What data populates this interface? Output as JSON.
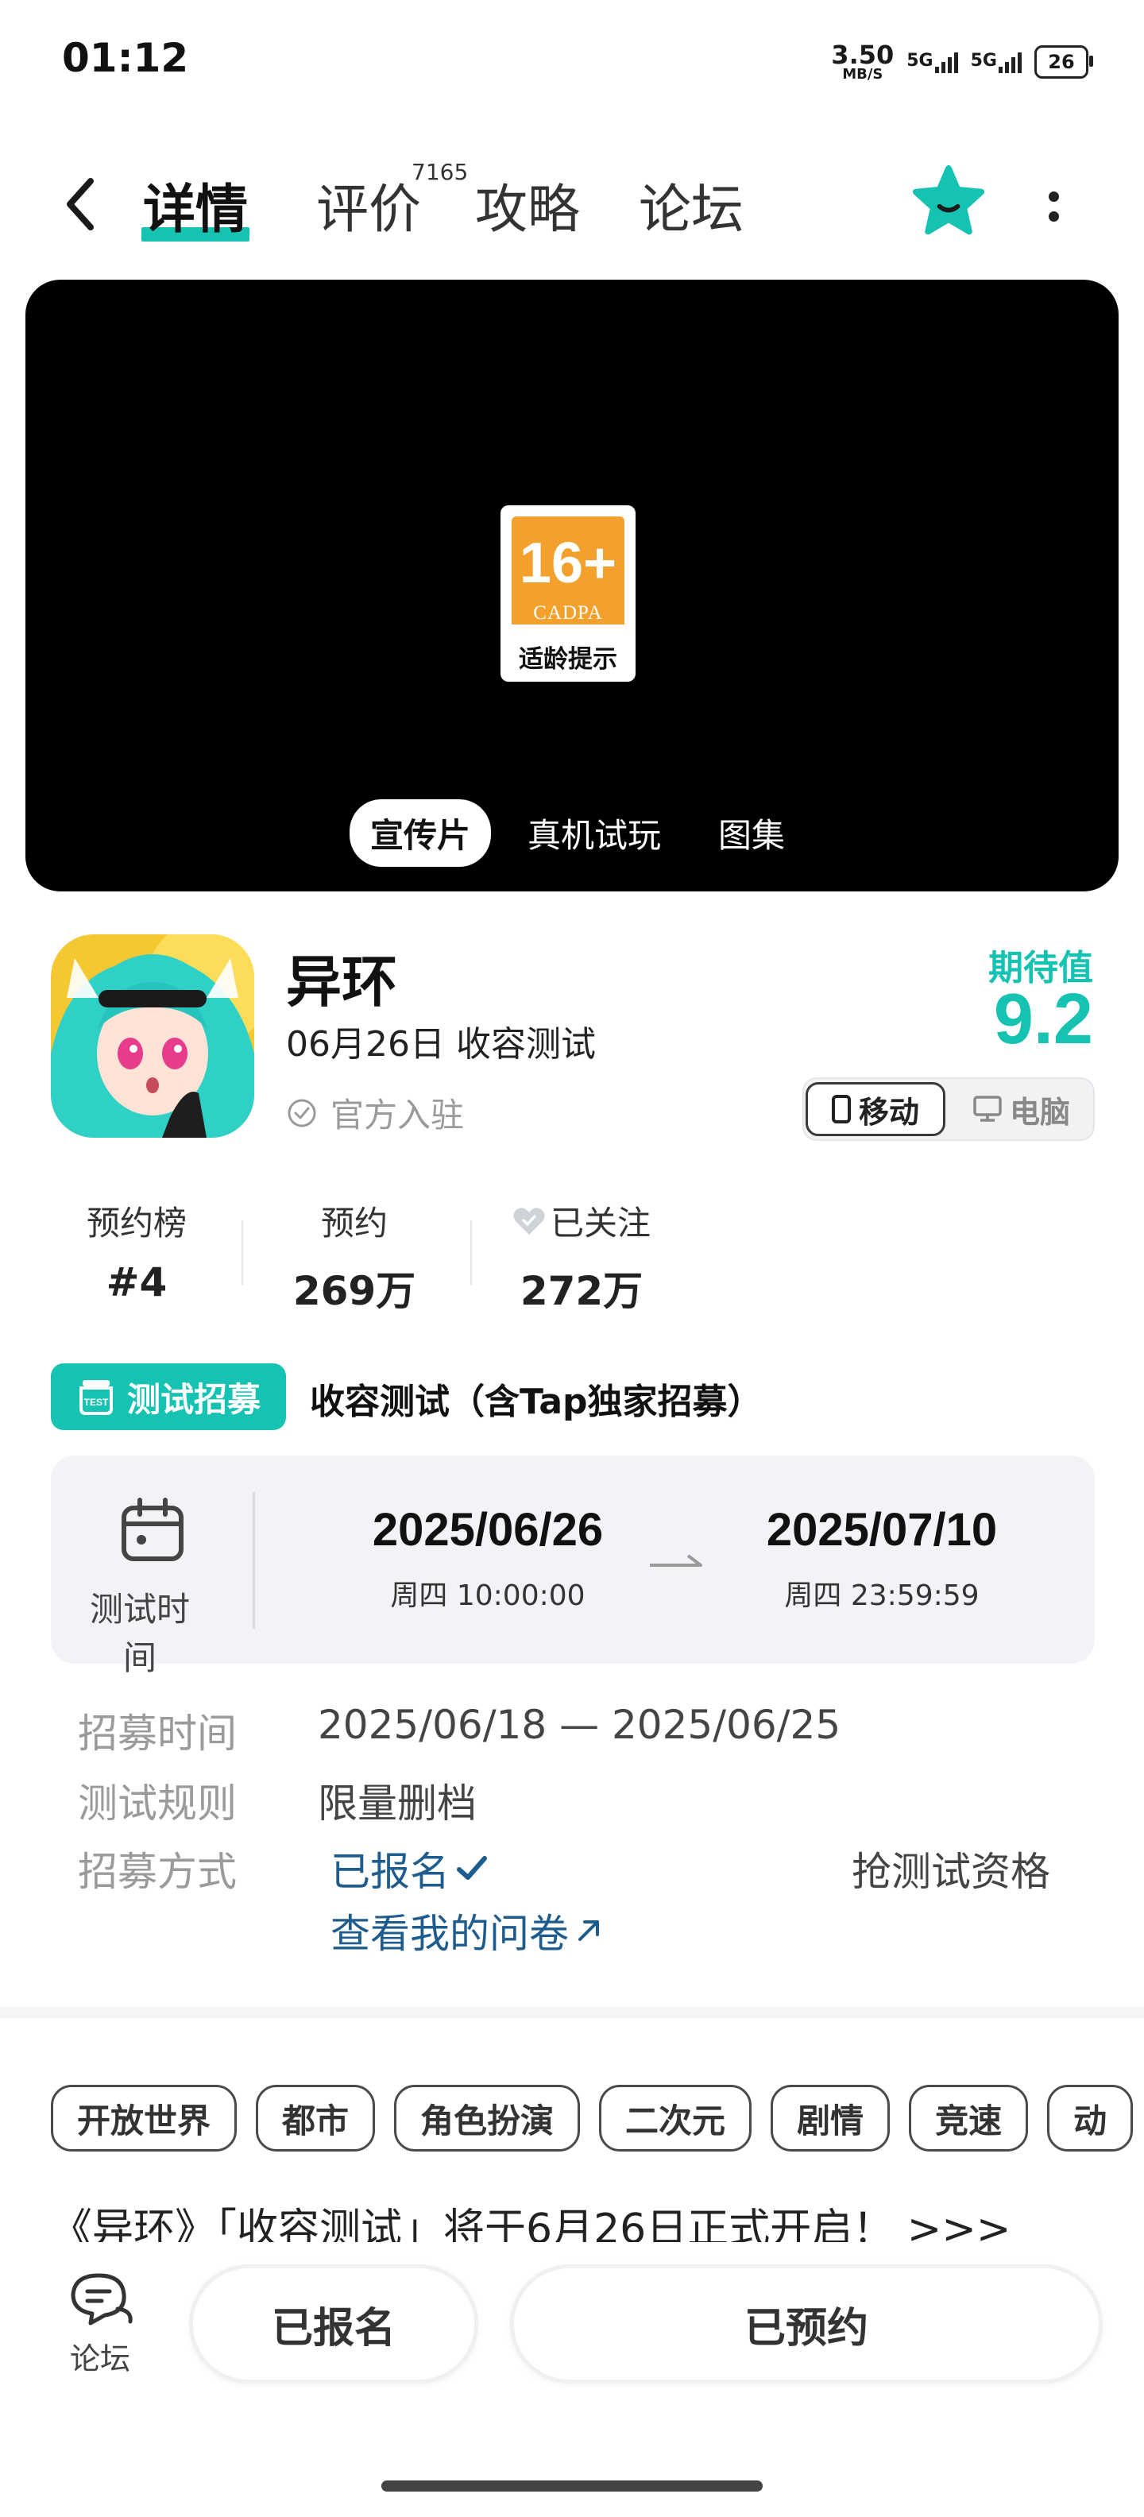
{
  "status_bar": {
    "time": "01:12",
    "speed_value": "3.50",
    "speed_unit": "MB/S",
    "network_1": "5G",
    "network_2": "5G",
    "battery": "26"
  },
  "nav": {
    "tabs": [
      "详情",
      "评价",
      "攻略",
      "论坛"
    ],
    "review_count": "7165",
    "active_tab": "详情"
  },
  "media": {
    "age_rating": "16+",
    "age_org": "CADPA",
    "age_label": "适龄提示",
    "tabs": [
      "宣传片",
      "真机试玩",
      "图集"
    ],
    "active_tab": "宣传片"
  },
  "game": {
    "name": "异环",
    "test_date": "06月26日 收容测试",
    "official": "官方入驻",
    "expect_label": "期待值",
    "expect_score": "9.2",
    "platforms": [
      "移动",
      "电脑"
    ],
    "active_platform": "移动"
  },
  "stats": [
    {
      "label": "预约榜",
      "value": "#4"
    },
    {
      "label": "预约",
      "value": "269万"
    },
    {
      "label": "已关注",
      "value": "272万"
    }
  ],
  "recruit": {
    "badge": "测试招募",
    "title": "收容测试（含Tap独家招募）",
    "test_time_label": "测试时间",
    "start_date": "2025/06/26",
    "start_time": "周四  10:00:00",
    "end_date": "2025/07/10",
    "end_time": "周四  23:59:59",
    "recruit_time_label": "招募时间",
    "recruit_time_value": "2025/06/18 — 2025/06/25",
    "rule_label": "测试规则",
    "rule_value": "限量删档",
    "method_label": "招募方式",
    "method_value": "已报名",
    "questionnaire_link": "查看我的问卷",
    "grab_action": "抢测试资格"
  },
  "tags": [
    "开放世界",
    "都市",
    "角色扮演",
    "二次元",
    "剧情",
    "竞速",
    "动"
  ],
  "announcement": "《异环》「收容测试」将于6月26日正式开启！ >>>",
  "bottom": {
    "forum_label": "论坛",
    "registered_label": "已报名",
    "reserved_label": "已预约"
  },
  "colors": {
    "accent": "#16c3b2",
    "link": "#1e5c8e",
    "age_orange": "#f3a12c"
  }
}
